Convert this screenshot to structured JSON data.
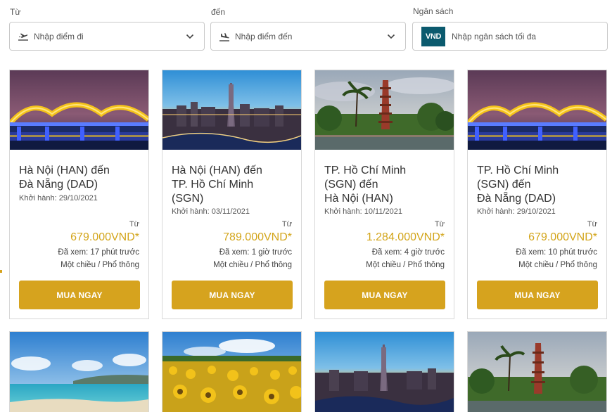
{
  "filters": {
    "from": {
      "label": "Từ",
      "placeholder": "Nhập điểm đi"
    },
    "to": {
      "label": "đến",
      "placeholder": "Nhập điểm đến"
    },
    "budget": {
      "label": "Ngân sách",
      "currency_badge": "VND",
      "placeholder": "Nhập ngân sách tối đa"
    }
  },
  "cards": [
    {
      "route_line1": "Hà Nội (HAN) đến",
      "route_line2": "Đà Nẵng (DAD)",
      "route_line3": "",
      "departure": "Khởi hành: 29/10/2021",
      "from_label": "Từ",
      "price": "679.000VND*",
      "viewed": "Đã xem: 17 phút trước",
      "fare_type": "Một chiều / Phổ thông",
      "button": "MUA NGAY",
      "image": "dragon-bridge-da-nang-night"
    },
    {
      "route_line1": "Hà Nội (HAN) đến",
      "route_line2": "TP. Hồ Chí Minh",
      "route_line3": "(SGN)",
      "departure": "Khởi hành: 03/11/2021",
      "from_label": "Từ",
      "price": "789.000VND*",
      "viewed": "Đã xem: 1 giờ trước",
      "fare_type": "Một chiều / Phổ thông",
      "button": "MUA NGAY",
      "image": "ho-chi-minh-city-skyline-sunset"
    },
    {
      "route_line1": "TP. Hồ Chí Minh",
      "route_line2": "(SGN) đến",
      "route_line3": "Hà Nội (HAN)",
      "departure": "Khởi hành: 10/11/2021",
      "from_label": "Từ",
      "price": "1.284.000VND*",
      "viewed": "Đã xem: 4 giờ trước",
      "fare_type": "Một chiều / Phổ thông",
      "button": "MUA NGAY",
      "image": "tran-quoc-pagoda-hanoi"
    },
    {
      "route_line1": "TP. Hồ Chí Minh",
      "route_line2": "(SGN) đến",
      "route_line3": "Đà Nẵng (DAD)",
      "departure": "Khởi hành: 29/10/2021",
      "from_label": "Từ",
      "price": "679.000VND*",
      "viewed": "Đã xem: 10 phút trước",
      "fare_type": "Một chiều / Phổ thông",
      "button": "MUA NGAY",
      "image": "dragon-bridge-da-nang-night"
    }
  ],
  "row2_images": [
    "tropical-beach-coast",
    "sunflower-field",
    "ho-chi-minh-city-skyline-sunset",
    "tran-quoc-pagoda-hanoi"
  ],
  "colors": {
    "accent": "#d6a31e",
    "price": "#d3a51a",
    "badge": "#0b5a6e",
    "border": "#c9c9c9"
  }
}
